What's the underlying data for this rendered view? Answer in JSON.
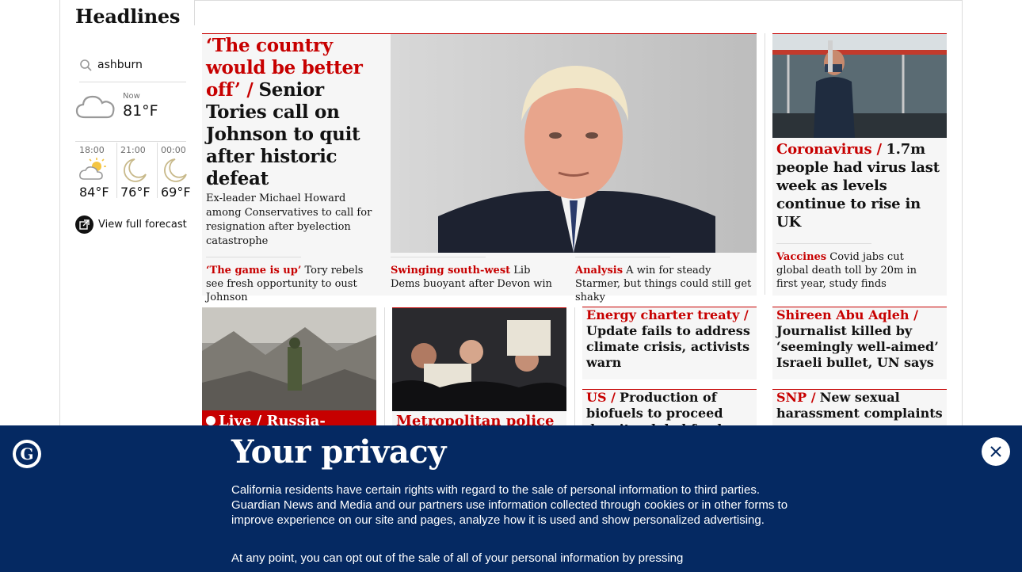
{
  "section": {
    "title": "Headlines"
  },
  "weather": {
    "search_value": "ashburn",
    "now_label": "Now",
    "now_temp": "81°F",
    "now_icon": "cloud-icon",
    "forecast": [
      {
        "time": "18:00",
        "temp": "84°F",
        "icon": "partly-sunny-icon"
      },
      {
        "time": "21:00",
        "temp": "76°F",
        "icon": "moon-icon"
      },
      {
        "time": "00:00",
        "temp": "69°F",
        "icon": "moon-icon"
      }
    ],
    "full_forecast_label": "View full forecast"
  },
  "lead": {
    "kicker": "‘The country would be better off’ /",
    "headline": "Senior Tories call on Johnson to quit after historic defeat",
    "standfirst": "Ex-leader Michael Howard among Conservatives to call for resignation after byelection catastrophe",
    "sublinks": [
      {
        "kicker": "‘The game is up’",
        "text": "Tory rebels see fresh opportunity to oust Johnson"
      },
      {
        "kicker": "Swinging south-west",
        "text": "Lib Dems buoyant after Devon win"
      },
      {
        "kicker": "Analysis",
        "text": "A win for steady Starmer, but things could still get shaky"
      }
    ]
  },
  "right_top": {
    "kicker": "Coronavirus /",
    "headline": "1.7m people had virus last week as levels continue to rise in UK",
    "sublink_kicker": "Vaccines",
    "sublink_text": "Covid jabs cut global death toll by 20m in first year, study finds"
  },
  "row2": {
    "ukraine": {
      "kicker": "Live / Russia-"
    },
    "met": {
      "kicker": "Metropolitan police /"
    },
    "energy": {
      "kicker": "Energy charter treaty /",
      "headline": "Update fails to address climate crisis, activists warn"
    },
    "abu_aqleh": {
      "kicker": "Shireen Abu Aqleh  /",
      "headline": "Journalist killed by ‘seemingly well-aimed’ Israeli bullet, UN says"
    },
    "biofuels": {
      "kicker": "US /",
      "headline": "Production of biofuels to proceed despite global food crisis"
    },
    "snp": {
      "kicker": "SNP /",
      "headline": "New sexual harassment complaints"
    }
  },
  "banner": {
    "title": "Your privacy",
    "para1": "California residents have certain rights with regard to the sale of personal information to third parties. Guardian News and Media and our partners use information collected through cookies or in other forms to improve experience on our site and pages, analyze how it is used and show personalized advertising.",
    "para2": "At any point, you can opt out of the sale of all of your personal information by pressing"
  },
  "colors": {
    "brand_blue": "#052962",
    "news_red": "#c70000"
  }
}
